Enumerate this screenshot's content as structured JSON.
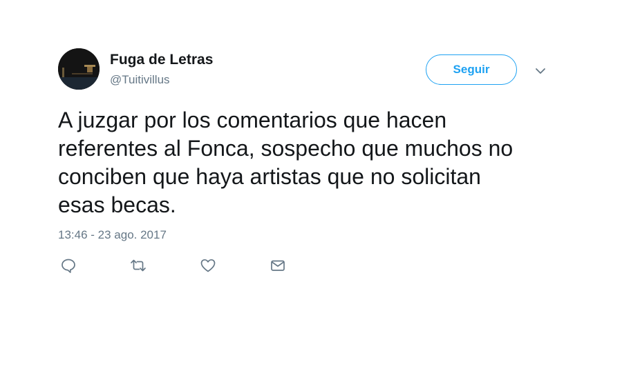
{
  "author": {
    "display_name": "Fuga de Letras",
    "handle": "@Tuitivillus"
  },
  "follow_button": {
    "label": "Seguir"
  },
  "tweet": {
    "text_lines": [
      "A juzgar por los comentarios que hacen",
      "referentes al Fonca, sospecho que muchos no",
      "conciben que haya artistas que no solicitan",
      "esas becas."
    ],
    "timestamp": "13:46 - 23 ago. 2017"
  },
  "actions": {
    "icons": [
      "reply-icon",
      "retweet-icon",
      "like-icon",
      "direct-message-icon"
    ]
  },
  "colors": {
    "accent": "#1da1f2",
    "text": "#14171a",
    "muted": "#657786"
  }
}
